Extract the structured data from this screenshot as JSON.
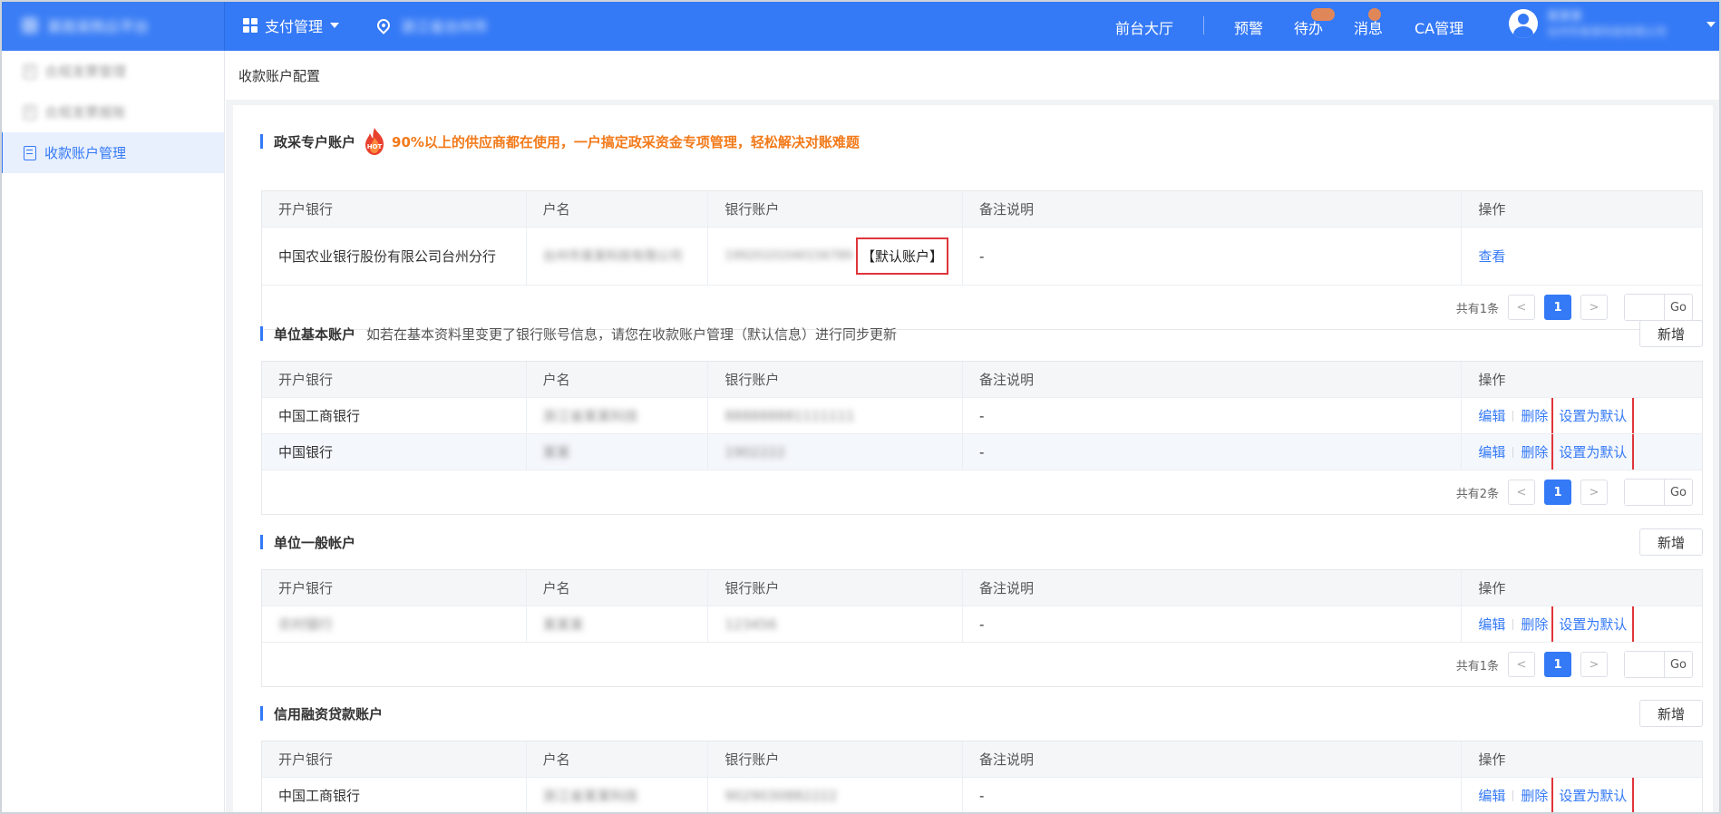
{
  "header": {
    "brand": "某政采购云平台",
    "nav_pay": "支付管理",
    "location": "浙江省台州市",
    "links": {
      "front_hall": "前台大厅",
      "warning": "预警",
      "todo": "待办",
      "message": "消息",
      "ca_manage": "CA管理"
    },
    "user": {
      "name": "某某某",
      "company": "台州市某某科技有限公司"
    }
  },
  "sidebar": {
    "items": [
      {
        "label": "合规发票管理"
      },
      {
        "label": "合规发票报账"
      },
      {
        "label": "收款账户管理"
      }
    ]
  },
  "breadcrumb": {
    "title": "收款账户配置"
  },
  "columns": {
    "bank": "开户银行",
    "name": "户名",
    "account": "银行账户",
    "remark": "备注说明",
    "ops": "操作"
  },
  "ops": {
    "view": "查看",
    "edit": "编辑",
    "delete": "删除",
    "set_default": "设置为默认",
    "add": "新增"
  },
  "sections": {
    "special": {
      "title": "政采专户账户",
      "hot_badge": "HOT",
      "promo": "90%以上的供应商都在使用，一户搞定政采资金专项管理，轻松解决对账难题",
      "rows": [
        {
          "bank": "中国农业银行股份有限公司台州分行",
          "name": "台州市某某科技有限公司",
          "account": "19920101040156789",
          "default_tag": "【默认账户】",
          "remark": "-"
        }
      ],
      "pager": {
        "total": "共有1条",
        "page": "1",
        "go": "Go"
      }
    },
    "basic": {
      "title": "单位基本账户",
      "hint": "如若在基本资料里变更了银行账号信息，请您在收款账户管理（默认信息）进行同步更新",
      "rows": [
        {
          "bank": "中国工商银行",
          "name": "浙江省某某科技",
          "account": "888888881111111",
          "remark": "-"
        },
        {
          "bank": "中国银行",
          "name": "某某",
          "account": "1902222",
          "remark": "-"
        }
      ],
      "pager": {
        "total": "共有2条",
        "page": "1",
        "go": "Go"
      }
    },
    "general": {
      "title": "单位一般帐户",
      "rows": [
        {
          "bank": "农村银行",
          "name": "某某某",
          "account": "123456",
          "remark": "-"
        }
      ],
      "pager": {
        "total": "共有1条",
        "page": "1",
        "go": "Go"
      }
    },
    "credit": {
      "title": "信用融资贷款账户",
      "rows": [
        {
          "bank": "中国工商银行",
          "name": "浙江省某某科技",
          "account": "9029030882222",
          "remark": "-"
        }
      ]
    }
  },
  "colors": {
    "primary": "#3479f6",
    "promo_orange": "#f27a1a",
    "highlight_red": "#e0353a"
  }
}
